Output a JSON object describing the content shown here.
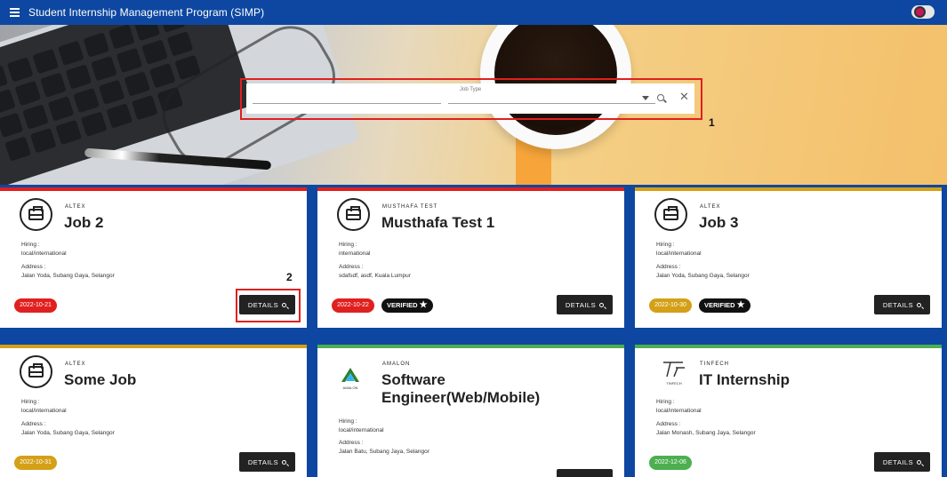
{
  "appbar": {
    "title": "Student Internship Management Program (SIMP)"
  },
  "search": {
    "jobtype_label": "Job Type",
    "clear_symbol": "✕"
  },
  "annotations": {
    "one": "1",
    "two": "2"
  },
  "colors": {
    "primary": "#0d47a1",
    "red": "#e0201f",
    "gold": "#d4a017",
    "green": "#4caf50"
  },
  "labels": {
    "hiring": "Hiring :",
    "address": "Address :",
    "details": "DETAILS",
    "verified": "VERIFIED"
  },
  "cards": [
    {
      "company": "ALTEX",
      "title": "Job 2",
      "hiring": "local/international",
      "address": "Jalan Yoda, Subang Gaya, Selangor",
      "date": "2022-10-21",
      "verified": false,
      "logo": "briefcase-icon"
    },
    {
      "company": "MUSTHAFA TEST",
      "title": "Musthafa Test 1",
      "hiring": "international",
      "address": "sdafsdf, asdf, Kuala Lumpur",
      "date": "2022-10-22",
      "verified": true,
      "logo": "briefcase-icon"
    },
    {
      "company": "ALTEX",
      "title": "Job 3",
      "hiring": "local/international",
      "address": "Jalan Yoda, Subang Gaya, Selangor",
      "date": "2022-10-30",
      "verified": true,
      "logo": "briefcase-icon"
    },
    {
      "company": "ALTEX",
      "title": "Some Job",
      "hiring": "local/international",
      "address": "Jalan Yoda, Subang Gaya, Selangor",
      "date": "2022-10-31",
      "verified": false,
      "logo": "briefcase-icon"
    },
    {
      "company": "AMALON",
      "title": "Software Engineer(Web/Mobile)",
      "hiring": "local/international",
      "address": "Jalan Batu, Subang Jaya, Selangor",
      "date": "",
      "verified": false,
      "logo": "amalon-logo",
      "logo_text": "AMALON"
    },
    {
      "company": "TINFECH",
      "title": "IT Internship",
      "hiring": "local/international",
      "address": "Jalan Monash, Subang Jaya, Selangor",
      "date": "2022-12-06",
      "verified": false,
      "logo": "tinfech-logo",
      "logo_text": "TINFECH"
    }
  ]
}
